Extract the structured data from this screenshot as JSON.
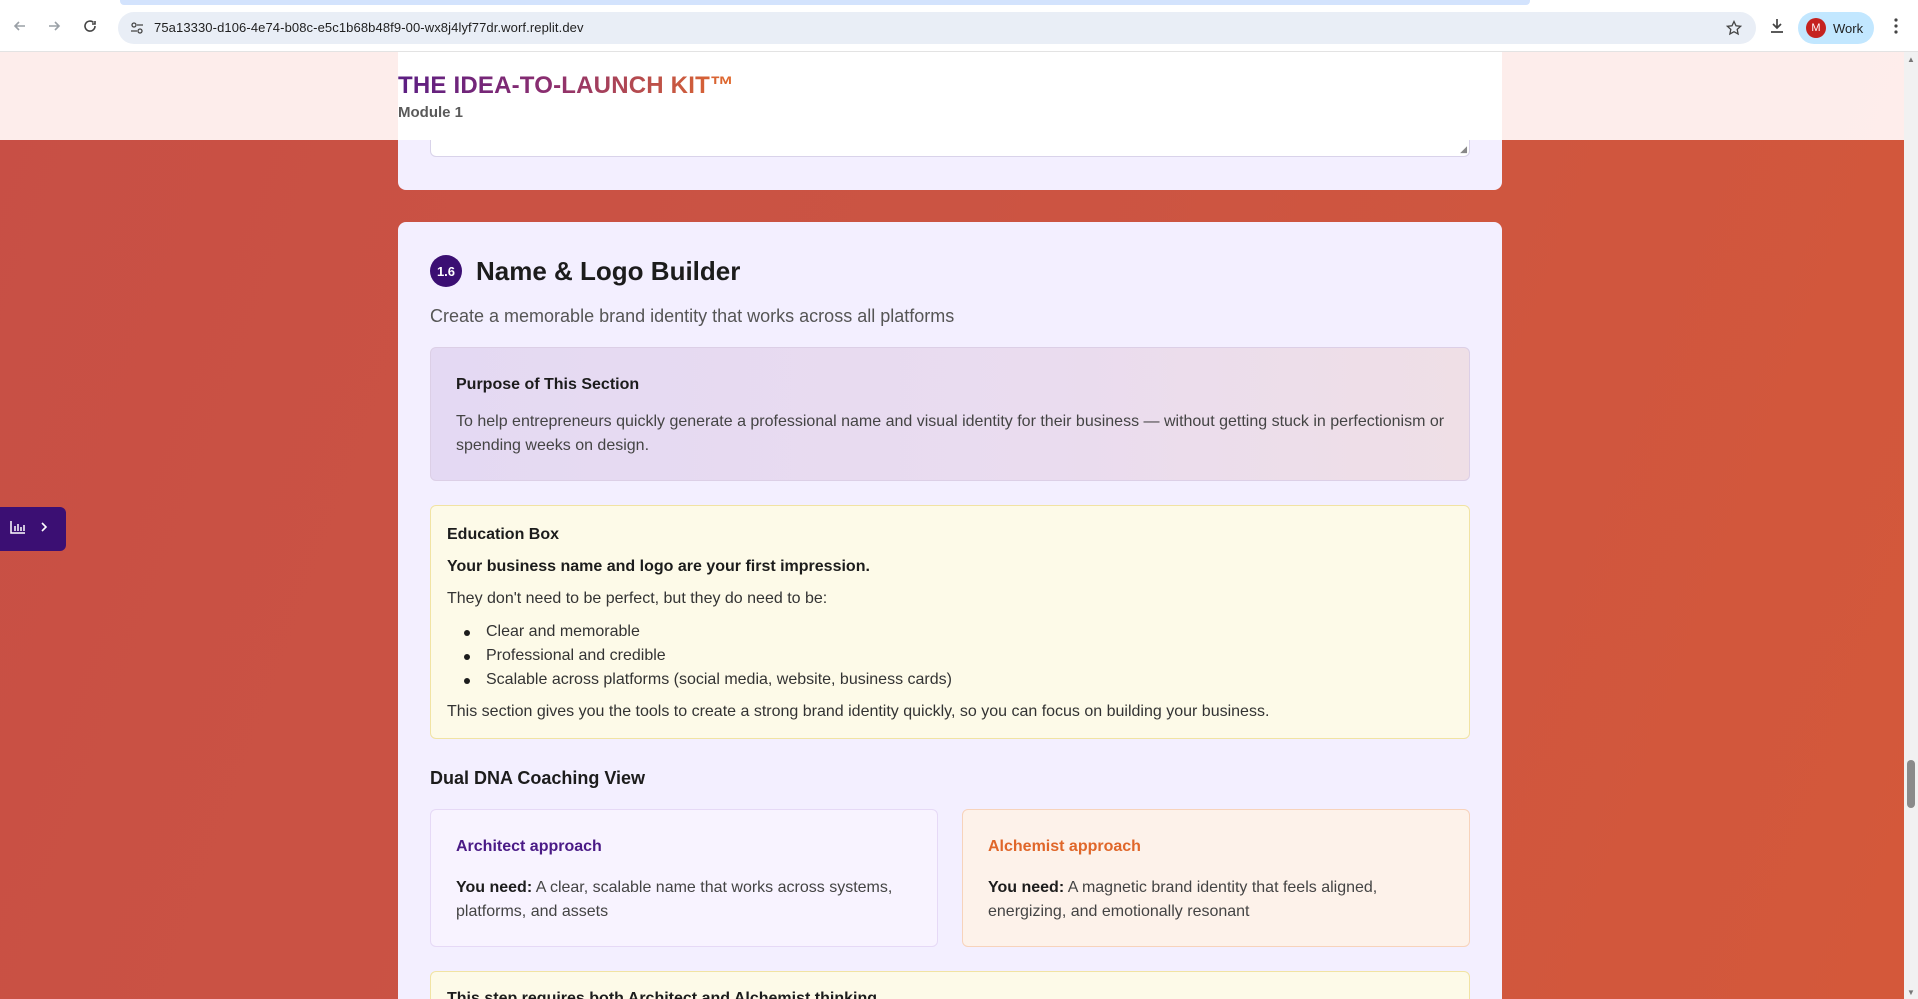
{
  "browser": {
    "url": "75a13330-d106-4e74-b08c-e5c1b68b48f9-00-wx8j4lyf77dr.worf.replit.dev",
    "profile_initial": "M",
    "profile_label": "Work"
  },
  "header": {
    "title": "THE IDEA-TO-LAUNCH KIT™",
    "module": "Module 1"
  },
  "section": {
    "number": "1.6",
    "title": "Name & Logo Builder",
    "subtitle": "Create a memorable brand identity that works across all platforms",
    "purpose": {
      "heading": "Purpose of This Section",
      "text": "To help entrepreneurs quickly generate a professional name and visual identity for their business — without getting stuck in perfectionism or spending weeks on design."
    },
    "education": {
      "heading": "Education Box",
      "lead": "Your business name and logo are your first impression.",
      "intro": "They don't need to be perfect, but they do need to be:",
      "items": [
        "Clear and memorable",
        "Professional and credible",
        "Scalable across platforms (social media, website, business cards)"
      ],
      "outro": "This section gives you the tools to create a strong brand identity quickly, so you can focus on building your business."
    },
    "dna": {
      "heading": "Dual DNA Coaching View",
      "architect": {
        "title": "Architect approach",
        "need_label": "You need:",
        "need_text": " A clear, scalable name that works across systems, platforms, and assets"
      },
      "alchemist": {
        "title": "Alchemist approach",
        "need_label": "You need:",
        "need_text": " A magnetic brand identity that feels aligned, energizing, and emotionally resonant"
      }
    },
    "thinking_note": "This step requires both Architect and Alchemist thinking."
  },
  "colors": {
    "background": "#c84f45",
    "brand_purple": "#3b0f73",
    "brand_orange": "#e0672a",
    "card": "#f3efff"
  },
  "icons": {
    "side_tab": [
      "bar-chart-icon",
      "chevron-right-icon"
    ]
  }
}
